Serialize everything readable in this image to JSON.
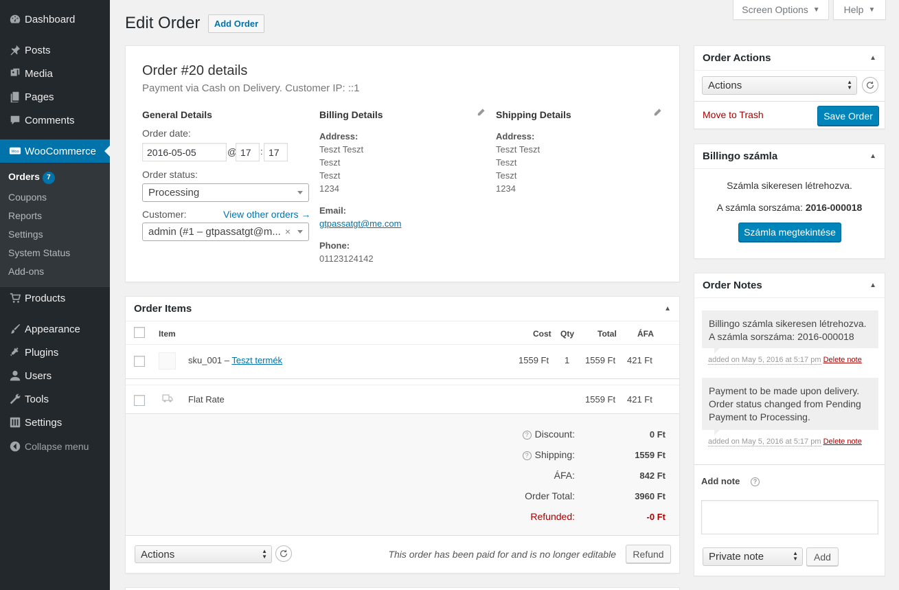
{
  "sidebar": {
    "items": [
      {
        "label": "Dashboard",
        "icon": "dashboard-icon"
      },
      {
        "label": "Posts",
        "icon": "pin-icon"
      },
      {
        "label": "Media",
        "icon": "media-icon"
      },
      {
        "label": "Pages",
        "icon": "pages-icon"
      },
      {
        "label": "Comments",
        "icon": "comments-icon"
      },
      {
        "label": "WooCommerce",
        "icon": "woo-icon"
      },
      {
        "label": "Products",
        "icon": "cart-icon"
      },
      {
        "label": "Appearance",
        "icon": "brush-icon"
      },
      {
        "label": "Plugins",
        "icon": "plug-icon"
      },
      {
        "label": "Users",
        "icon": "user-icon"
      },
      {
        "label": "Tools",
        "icon": "wrench-icon"
      },
      {
        "label": "Settings",
        "icon": "settings-icon"
      }
    ],
    "submenu": [
      {
        "label": "Orders",
        "badge": "7"
      },
      {
        "label": "Coupons"
      },
      {
        "label": "Reports"
      },
      {
        "label": "Settings"
      },
      {
        "label": "System Status"
      },
      {
        "label": "Add-ons"
      }
    ],
    "collapse": "Collapse menu"
  },
  "top": {
    "screen_options": "Screen Options",
    "help": "Help",
    "title": "Edit Order",
    "add_order": "Add Order"
  },
  "order": {
    "heading": "Order #20 details",
    "meta": "Payment via Cash on Delivery. Customer IP: ::1",
    "general": {
      "title": "General Details",
      "date_label": "Order date:",
      "date": "2016-05-05",
      "at": "@",
      "hour": "17",
      "colon": ":",
      "minute": "17",
      "status_label": "Order status:",
      "status": "Processing",
      "customer_label": "Customer:",
      "view_other": "View other orders →",
      "customer": "admin (#1 – gtpassatgt@m...",
      "clear": "×"
    },
    "billing": {
      "title": "Billing Details",
      "address_label": "Address:",
      "address": [
        "Teszt Teszt",
        "Teszt",
        "Teszt",
        "1234"
      ],
      "email_label": "Email:",
      "email": "gtpassatgt@me.com",
      "phone_label": "Phone:",
      "phone": "01123124142"
    },
    "shipping": {
      "title": "Shipping Details",
      "address_label": "Address:",
      "address": [
        "Teszt Teszt",
        "Teszt",
        "Teszt",
        "1234"
      ]
    }
  },
  "items": {
    "title": "Order Items",
    "headers": {
      "item": "Item",
      "cost": "Cost",
      "qty": "Qty",
      "total": "Total",
      "afa": "ÁFA"
    },
    "product": {
      "sku": "sku_001 – ",
      "name": "Teszt termék",
      "cost": "1559 Ft",
      "qty": "1",
      "total": "1559 Ft",
      "afa": "421 Ft"
    },
    "shipping": {
      "name": "Flat Rate",
      "total": "1559 Ft",
      "afa": "421 Ft"
    },
    "totals": {
      "discount_label": "Discount:",
      "discount": "0 Ft",
      "shipping_label": "Shipping:",
      "shipping": "1559 Ft",
      "afa_label": "ÁFA:",
      "afa": "842 Ft",
      "order_total_label": "Order Total:",
      "order_total": "3960 Ft",
      "refunded_label": "Refunded:",
      "refunded": "-0 Ft"
    },
    "actions": "Actions",
    "paid_note": "This order has been paid for and is no longer editable",
    "refund": "Refund"
  },
  "order_actions": {
    "title": "Order Actions",
    "select": "Actions",
    "trash": "Move to Trash",
    "save": "Save Order"
  },
  "billingo": {
    "title": "Billingo számla",
    "created": "Számla sikeresen létrehozva.",
    "number_prefix": "A számla sorszáma: ",
    "number": "2016-000018",
    "view": "Számla megtekintése"
  },
  "notes": {
    "title": "Order Notes",
    "list": [
      {
        "text": "Billingo számla sikeresen létrehozva. A számla sorszáma: 2016-000018",
        "meta": "added on May 5, 2016 at 5:17 pm",
        "delete": "Delete note"
      },
      {
        "text": "Payment to be made upon delivery. Order status changed from Pending Payment to Processing.",
        "meta": "added on May 5, 2016 at 5:17 pm",
        "delete": "Delete note"
      }
    ],
    "add_label": "Add note",
    "type": "Private note",
    "add_btn": "Add"
  },
  "colors": {
    "sidebar": "#23282d",
    "submenu": "#32373c",
    "accent": "#0073aa",
    "primary_button": "#0085ba",
    "danger": "#a00"
  }
}
